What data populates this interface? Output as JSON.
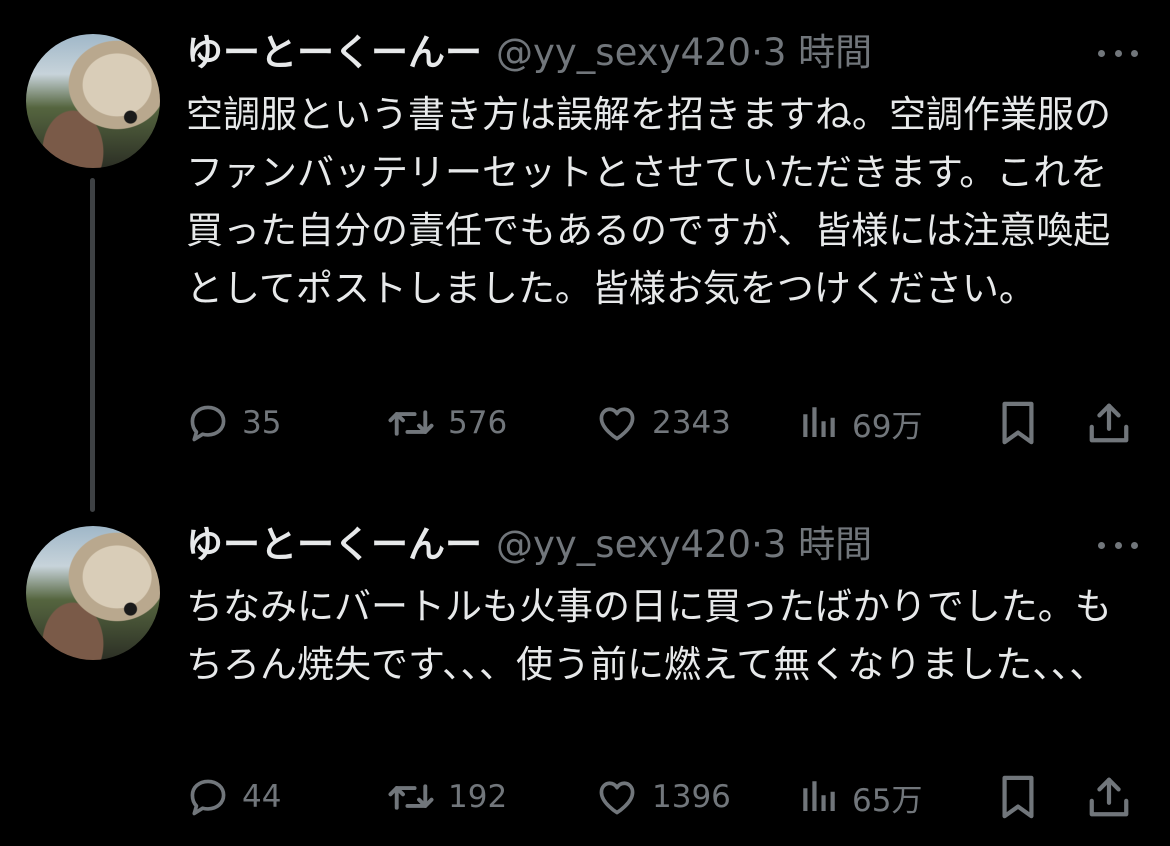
{
  "tweets": [
    {
      "name": "ゆーとーくーんー",
      "handle": "@yy_sexy420",
      "separator": "·",
      "time": "3 時間",
      "text": "空調服という書き方は誤解を招きますね。空調作業服のファンバッテリーセットとさせていただきます。これを買った自分の責任でもあるのですが、皆様には注意喚起としてポストしました。皆様お気をつけください。",
      "replies": "35",
      "retweets": "576",
      "likes": "2343",
      "views": "69万"
    },
    {
      "name": "ゆーとーくーんー",
      "handle": "@yy_sexy420",
      "separator": "·",
      "time": "3 時間",
      "text": "ちなみにバートルも火事の日に買ったばかりでした。もちろん焼失です、、、使う前に燃えて無くなりました、、、",
      "replies": "44",
      "retweets": "192",
      "likes": "1396",
      "views": "65万"
    }
  ],
  "icons": {
    "reply": "speech-bubble-icon",
    "retweet": "retweet-arrows-icon",
    "like": "heart-icon",
    "views": "bar-chart-icon",
    "bookmark": "bookmark-icon",
    "share": "share-upload-icon",
    "more": "ellipsis-icon"
  },
  "colors": {
    "background": "#000000",
    "text": "#e7e9ea",
    "muted": "#71767b",
    "thread_line": "#3e4144"
  }
}
